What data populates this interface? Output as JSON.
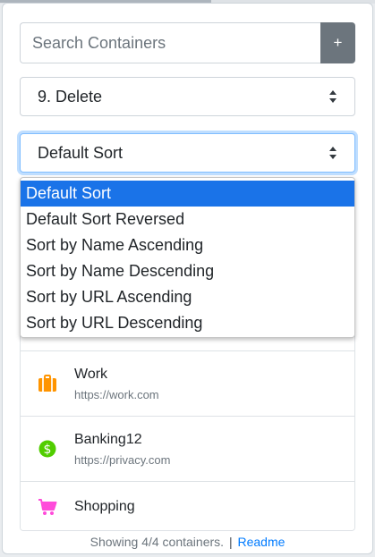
{
  "search": {
    "placeholder": "Search Containers",
    "add_label": "+"
  },
  "delete_select": {
    "value": "9. Delete"
  },
  "sort_select": {
    "value": "Default Sort",
    "options": [
      "Default Sort",
      "Default Sort Reversed",
      "Sort by Name Ascending",
      "Sort by Name Descending",
      "Sort by URL Ascending",
      "Sort by URL Descending"
    ]
  },
  "containers": [
    {
      "name": "Work",
      "url": "https://work.com",
      "icon": "briefcase-icon",
      "color": "#ff9400"
    },
    {
      "name": "Banking12",
      "url": "https://privacy.com",
      "icon": "dollar-icon",
      "color": "#51cd00"
    },
    {
      "name": "Shopping",
      "url": "",
      "icon": "cart-icon",
      "color": "#ff4bda"
    }
  ],
  "footer": {
    "status": "Showing 4/4 containers.",
    "separator": "|",
    "readme": "Readme"
  },
  "colors": {
    "accent": "#007bff",
    "selected": "#1a73e8",
    "button": "#6c757d"
  }
}
